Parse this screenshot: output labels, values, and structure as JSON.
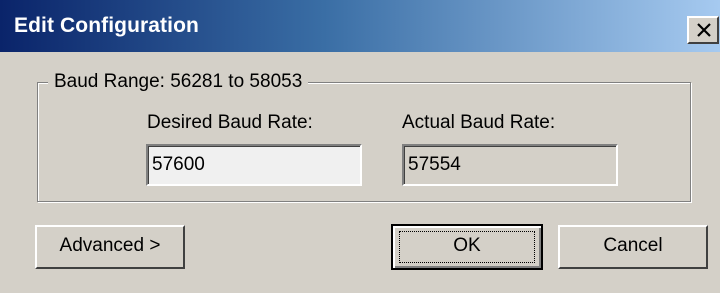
{
  "window": {
    "title": "Edit Configuration",
    "close_icon": "close-icon"
  },
  "baud_group": {
    "legend": "Baud Range: 56281 to 58053",
    "desired_label": "Desired Baud Rate:",
    "desired_value": "57600",
    "actual_label": "Actual Baud Rate:",
    "actual_value": "57554"
  },
  "buttons": {
    "advanced": "Advanced >",
    "ok": "OK",
    "cancel": "Cancel"
  },
  "colors": {
    "titlebar_start": "#0a246a",
    "titlebar_end": "#a6caf0",
    "dialog_face": "#d4d0c8"
  }
}
